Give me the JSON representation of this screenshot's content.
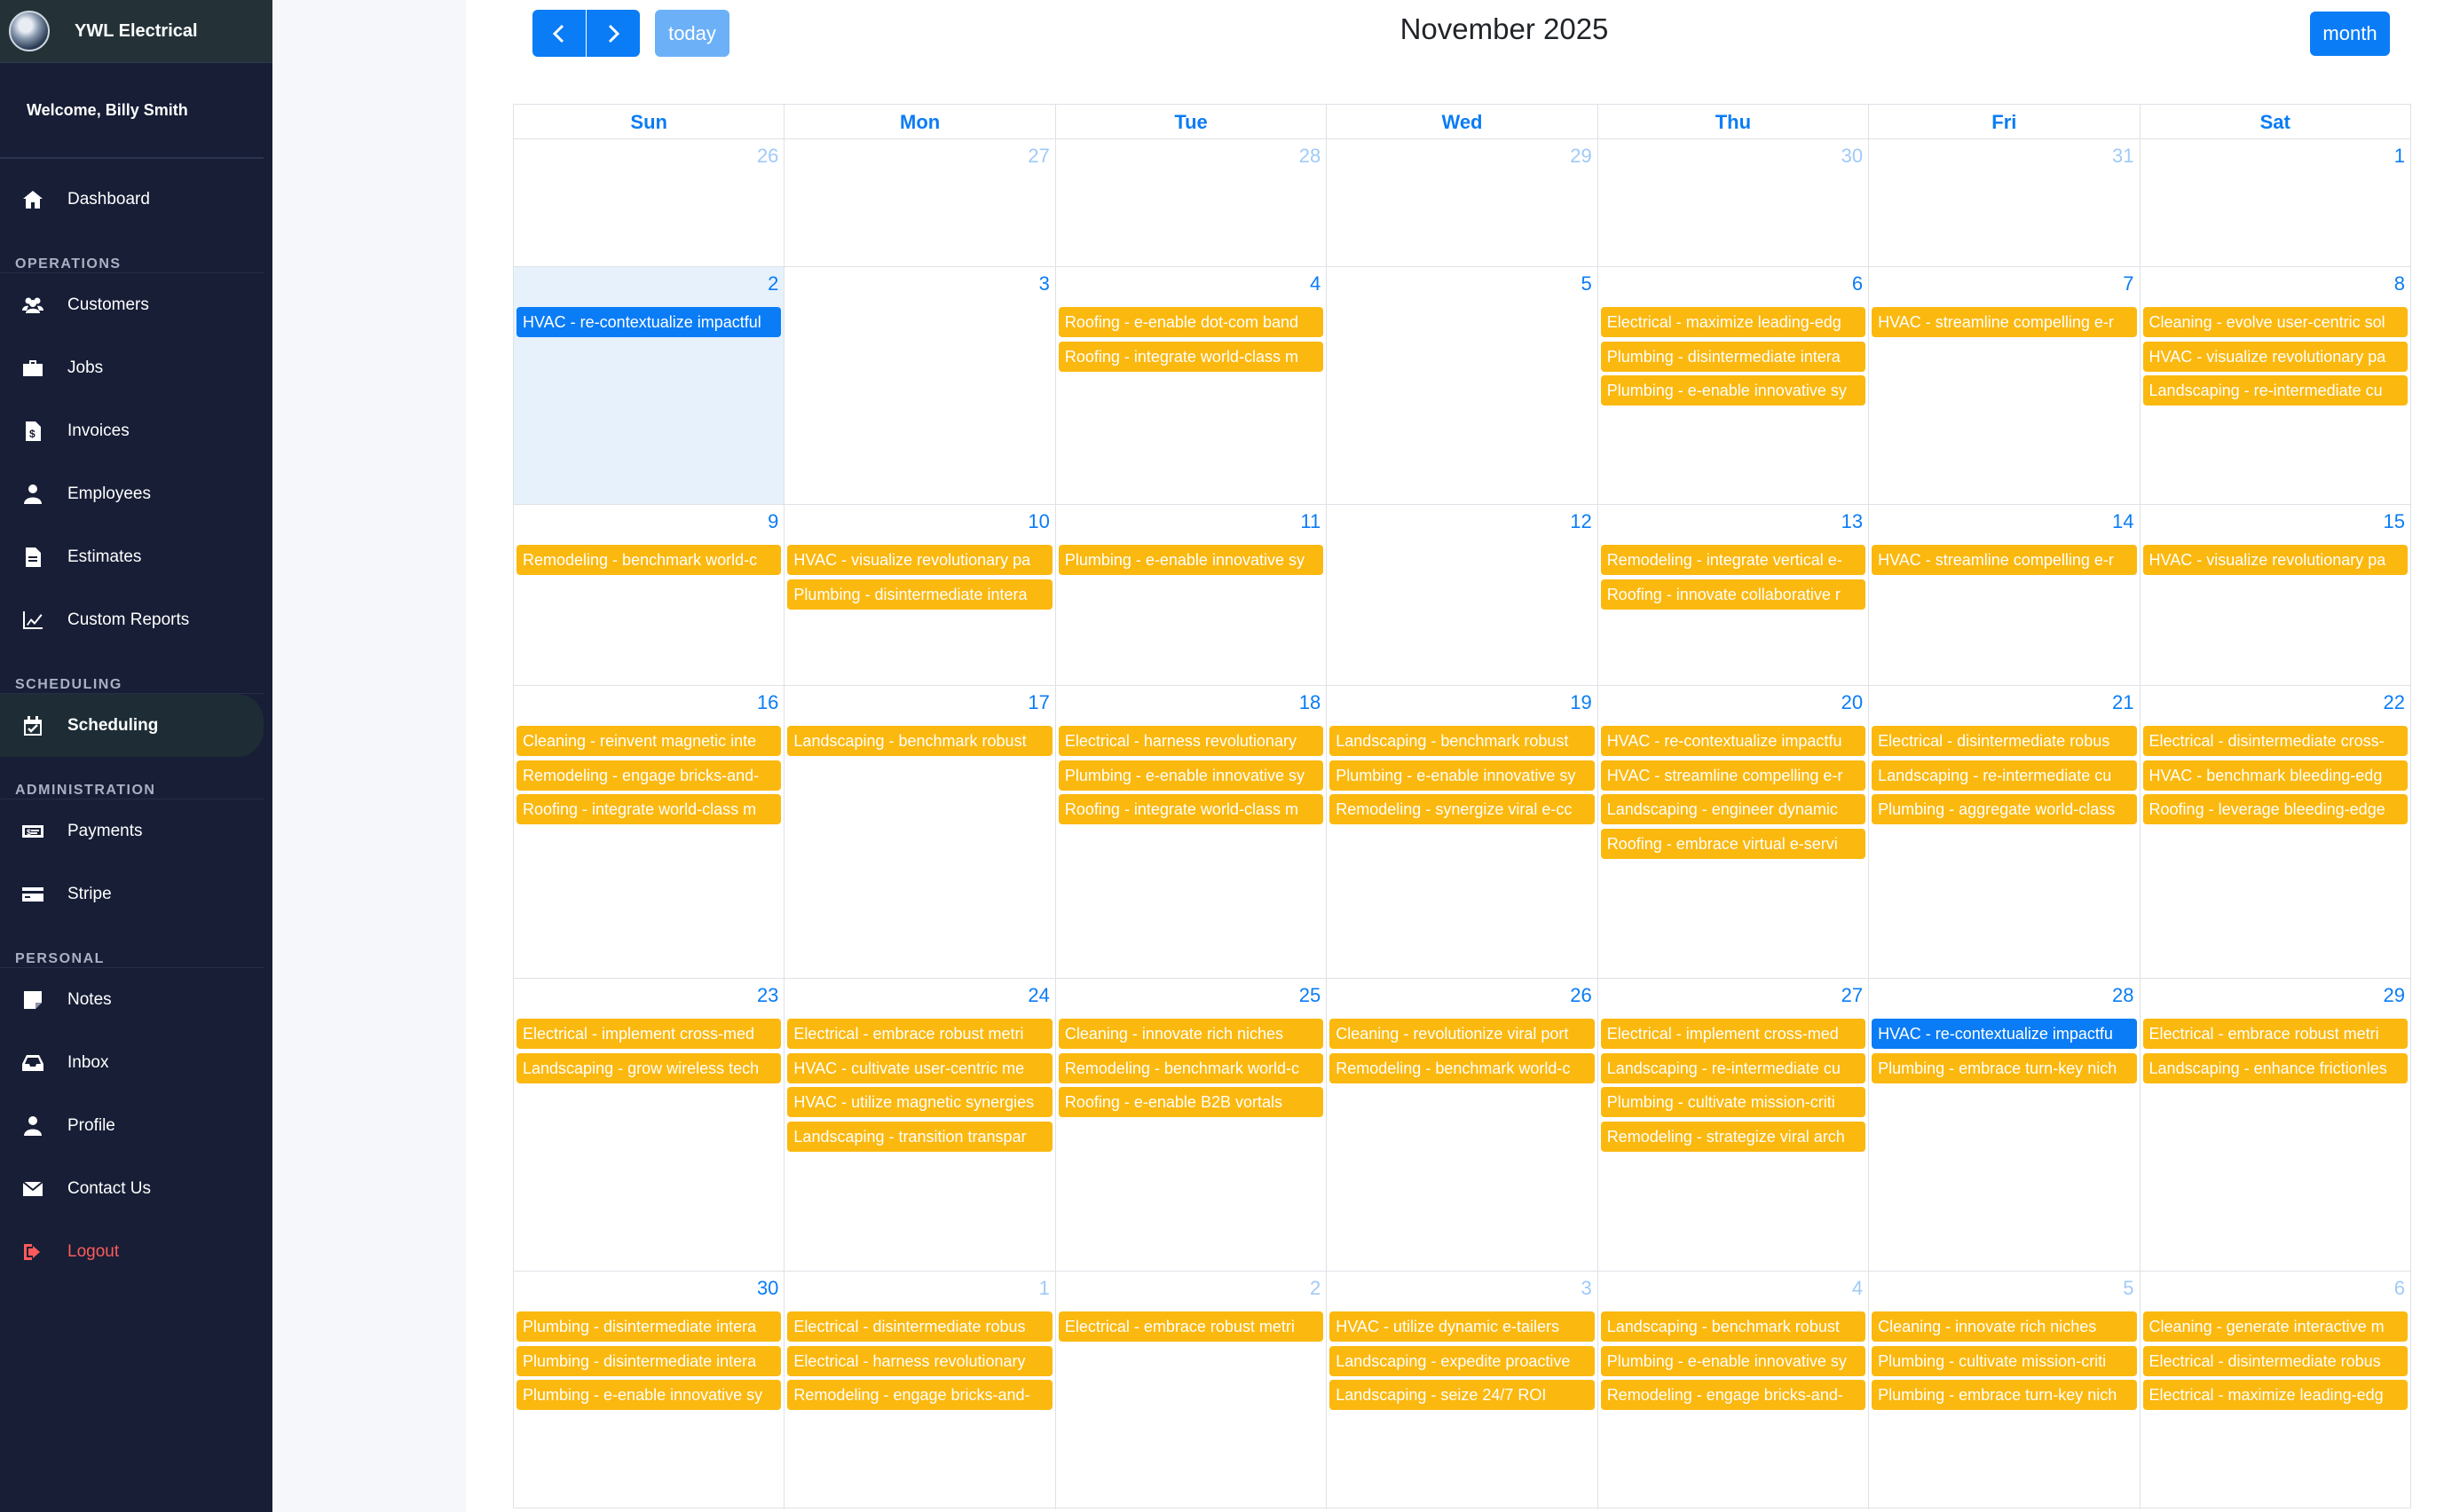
{
  "app": {
    "brand": "YWL Electrical",
    "welcome": "Welcome, Billy Smith"
  },
  "sidebar": {
    "top": [
      {
        "label": "Dashboard",
        "icon": "home-icon"
      }
    ],
    "sections": [
      {
        "title": "OPERATIONS",
        "items": [
          {
            "label": "Customers",
            "icon": "users-icon"
          },
          {
            "label": "Jobs",
            "icon": "briefcase-icon"
          },
          {
            "label": "Invoices",
            "icon": "invoice-icon"
          },
          {
            "label": "Employees",
            "icon": "employee-icon"
          },
          {
            "label": "Estimates",
            "icon": "file-icon"
          },
          {
            "label": "Custom Reports",
            "icon": "chart-line-icon"
          }
        ]
      },
      {
        "title": "SCHEDULING",
        "items": [
          {
            "label": "Scheduling",
            "icon": "calendar-check-icon",
            "active": true
          }
        ]
      },
      {
        "title": "ADMINISTRATION",
        "items": [
          {
            "label": "Payments",
            "icon": "money-bill-icon"
          },
          {
            "label": "Stripe",
            "icon": "credit-card-icon"
          }
        ]
      },
      {
        "title": "PERSONAL",
        "items": [
          {
            "label": "Notes",
            "icon": "note-icon"
          },
          {
            "label": "Inbox",
            "icon": "inbox-icon"
          },
          {
            "label": "Profile",
            "icon": "user-icon"
          },
          {
            "label": "Contact Us",
            "icon": "envelope-icon"
          },
          {
            "label": "Logout",
            "icon": "sign-out-icon",
            "logout": true
          }
        ]
      }
    ]
  },
  "calendar": {
    "title": "November 2025",
    "prev_label": "‹",
    "next_label": "›",
    "today_label": "today",
    "view_label": "month",
    "weekdays": [
      "Sun",
      "Mon",
      "Tue",
      "Wed",
      "Thu",
      "Fri",
      "Sat"
    ],
    "colors": {
      "event": "#fbb80f",
      "event_active": "#0a7cf6",
      "today_bg": "#e6f1fc"
    },
    "weeks": [
      [
        {
          "day": "26",
          "other": true,
          "events": []
        },
        {
          "day": "27",
          "other": true,
          "events": []
        },
        {
          "day": "28",
          "other": true,
          "events": []
        },
        {
          "day": "29",
          "other": true,
          "events": []
        },
        {
          "day": "30",
          "other": true,
          "events": []
        },
        {
          "day": "31",
          "other": true,
          "events": []
        },
        {
          "day": "1",
          "events": []
        }
      ],
      [
        {
          "day": "2",
          "today": true,
          "events": [
            {
              "title": "HVAC - re-contextualize impactful",
              "blue": true
            }
          ]
        },
        {
          "day": "3",
          "events": []
        },
        {
          "day": "4",
          "events": [
            {
              "title": "Roofing - e-enable dot-com band"
            },
            {
              "title": "Roofing - integrate world-class m"
            }
          ]
        },
        {
          "day": "5",
          "events": []
        },
        {
          "day": "6",
          "events": [
            {
              "title": "Electrical - maximize leading-edg"
            },
            {
              "title": "Plumbing - disintermediate intera"
            },
            {
              "title": "Plumbing - e-enable innovative sy"
            }
          ]
        },
        {
          "day": "7",
          "events": [
            {
              "title": "HVAC - streamline compelling e-r"
            }
          ]
        },
        {
          "day": "8",
          "events": [
            {
              "title": "Cleaning - evolve user-centric sol"
            },
            {
              "title": "HVAC - visualize revolutionary pa"
            },
            {
              "title": "Landscaping - re-intermediate cu"
            }
          ]
        }
      ],
      [
        {
          "day": "9",
          "events": [
            {
              "title": "Remodeling - benchmark world-c"
            }
          ]
        },
        {
          "day": "10",
          "events": [
            {
              "title": "HVAC - visualize revolutionary pa"
            },
            {
              "title": "Plumbing - disintermediate intera"
            }
          ]
        },
        {
          "day": "11",
          "events": [
            {
              "title": "Plumbing - e-enable innovative sy"
            }
          ]
        },
        {
          "day": "12",
          "events": []
        },
        {
          "day": "13",
          "events": [
            {
              "title": "Remodeling - integrate vertical e-"
            },
            {
              "title": "Roofing - innovate collaborative r"
            }
          ]
        },
        {
          "day": "14",
          "events": [
            {
              "title": "HVAC - streamline compelling e-r"
            }
          ]
        },
        {
          "day": "15",
          "events": [
            {
              "title": "HVAC - visualize revolutionary pa"
            }
          ]
        }
      ],
      [
        {
          "day": "16",
          "events": [
            {
              "title": "Cleaning - reinvent magnetic inte"
            },
            {
              "title": "Remodeling - engage bricks-and-"
            },
            {
              "title": "Roofing - integrate world-class m"
            }
          ]
        },
        {
          "day": "17",
          "events": [
            {
              "title": "Landscaping - benchmark robust"
            }
          ]
        },
        {
          "day": "18",
          "events": [
            {
              "title": "Electrical - harness revolutionary"
            },
            {
              "title": "Plumbing - e-enable innovative sy"
            },
            {
              "title": "Roofing - integrate world-class m"
            }
          ]
        },
        {
          "day": "19",
          "events": [
            {
              "title": "Landscaping - benchmark robust"
            },
            {
              "title": "Plumbing - e-enable innovative sy"
            },
            {
              "title": "Remodeling - synergize viral e-cc"
            }
          ]
        },
        {
          "day": "20",
          "events": [
            {
              "title": "HVAC - re-contextualize impactfu"
            },
            {
              "title": "HVAC - streamline compelling e-r"
            },
            {
              "title": "Landscaping - engineer dynamic"
            },
            {
              "title": "Roofing - embrace virtual e-servi"
            }
          ]
        },
        {
          "day": "21",
          "events": [
            {
              "title": "Electrical - disintermediate robus"
            },
            {
              "title": "Landscaping - re-intermediate cu"
            },
            {
              "title": "Plumbing - aggregate world-class"
            }
          ]
        },
        {
          "day": "22",
          "events": [
            {
              "title": "Electrical - disintermediate cross-"
            },
            {
              "title": "HVAC - benchmark bleeding-edg"
            },
            {
              "title": "Roofing - leverage bleeding-edge"
            }
          ]
        }
      ],
      [
        {
          "day": "23",
          "events": [
            {
              "title": "Electrical - implement cross-med"
            },
            {
              "title": "Landscaping - grow wireless tech"
            }
          ]
        },
        {
          "day": "24",
          "events": [
            {
              "title": "Electrical - embrace robust metri"
            },
            {
              "title": "HVAC - cultivate user-centric me"
            },
            {
              "title": "HVAC - utilize magnetic synergies"
            },
            {
              "title": "Landscaping - transition transpar"
            }
          ]
        },
        {
          "day": "25",
          "events": [
            {
              "title": "Cleaning - innovate rich niches"
            },
            {
              "title": "Remodeling - benchmark world-c"
            },
            {
              "title": "Roofing - e-enable B2B vortals"
            }
          ]
        },
        {
          "day": "26",
          "events": [
            {
              "title": "Cleaning - revolutionize viral port"
            },
            {
              "title": "Remodeling - benchmark world-c"
            }
          ]
        },
        {
          "day": "27",
          "events": [
            {
              "title": "Electrical - implement cross-med"
            },
            {
              "title": "Landscaping - re-intermediate cu"
            },
            {
              "title": "Plumbing - cultivate mission-criti"
            },
            {
              "title": "Remodeling - strategize viral arch"
            }
          ]
        },
        {
          "day": "28",
          "events": [
            {
              "title": "HVAC - re-contextualize impactfu",
              "blue": true
            },
            {
              "title": "Plumbing - embrace turn-key nich"
            }
          ]
        },
        {
          "day": "29",
          "events": [
            {
              "title": "Electrical - embrace robust metri"
            },
            {
              "title": "Landscaping - enhance frictionles"
            }
          ]
        }
      ],
      [
        {
          "day": "30",
          "events": [
            {
              "title": "Plumbing - disintermediate intera"
            },
            {
              "title": "Plumbing - disintermediate intera"
            },
            {
              "title": "Plumbing - e-enable innovative sy"
            }
          ]
        },
        {
          "day": "1",
          "other": true,
          "events": [
            {
              "title": "Electrical - disintermediate robus"
            },
            {
              "title": "Electrical - harness revolutionary"
            },
            {
              "title": "Remodeling - engage bricks-and-"
            }
          ]
        },
        {
          "day": "2",
          "other": true,
          "events": [
            {
              "title": "Electrical - embrace robust metri"
            }
          ]
        },
        {
          "day": "3",
          "other": true,
          "events": [
            {
              "title": "HVAC - utilize dynamic e-tailers"
            },
            {
              "title": "Landscaping - expedite proactive"
            },
            {
              "title": "Landscaping - seize 24/7 ROI"
            }
          ]
        },
        {
          "day": "4",
          "other": true,
          "events": [
            {
              "title": "Landscaping - benchmark robust"
            },
            {
              "title": "Plumbing - e-enable innovative sy"
            },
            {
              "title": "Remodeling - engage bricks-and-"
            }
          ]
        },
        {
          "day": "5",
          "other": true,
          "events": [
            {
              "title": "Cleaning - innovate rich niches"
            },
            {
              "title": "Plumbing - cultivate mission-criti"
            },
            {
              "title": "Plumbing - embrace turn-key nich"
            }
          ]
        },
        {
          "day": "6",
          "other": true,
          "events": [
            {
              "title": "Cleaning - generate interactive m"
            },
            {
              "title": "Electrical - disintermediate robus"
            },
            {
              "title": "Electrical - maximize leading-edg"
            }
          ]
        }
      ]
    ]
  }
}
